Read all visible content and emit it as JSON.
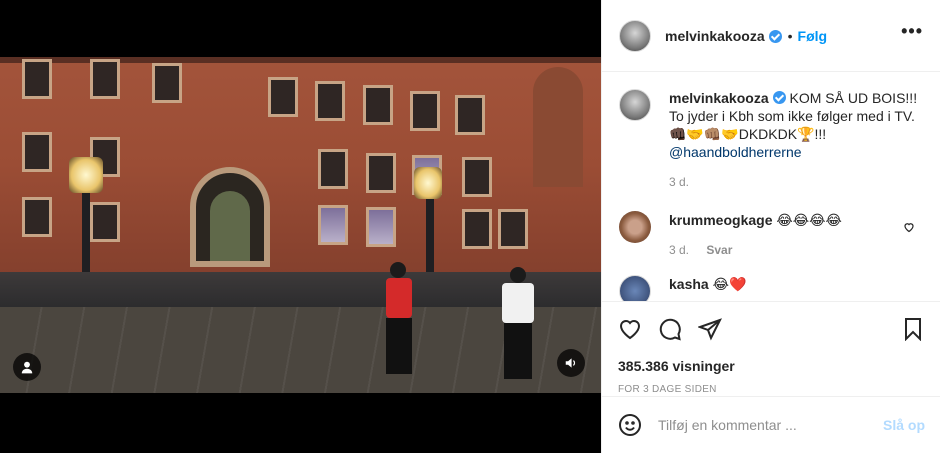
{
  "post": {
    "author": "melvinkakooza",
    "follow_label": "Følg",
    "more_label": "•••",
    "separator": "•"
  },
  "caption": {
    "author": "melvinkakooza",
    "text": "KOM SÅ UD BOIS!!! To jyder i Kbh som ikke følger med i TV. ",
    "emoji_text": "👊🏿🤝👊🏽🤝DKDKDK🏆!!! ",
    "mention": "@haandboldherrerne",
    "age": "3 d."
  },
  "comments": [
    {
      "author": "krummeogkage",
      "text": "😂😂😂😂",
      "age": "3 d.",
      "reply_label": "Svar"
    },
    {
      "author": "kasha",
      "text": "😂❤️"
    }
  ],
  "stats": {
    "views": "385.386 visninger",
    "timestamp": "FOR 3 DAGE SIDEN"
  },
  "composer": {
    "placeholder": "Tilføj en kommentar ...",
    "post_label": "Slå op"
  },
  "colors": {
    "accent": "#0095f6",
    "verified": "#3897f0",
    "muted": "#8e8e8e"
  }
}
